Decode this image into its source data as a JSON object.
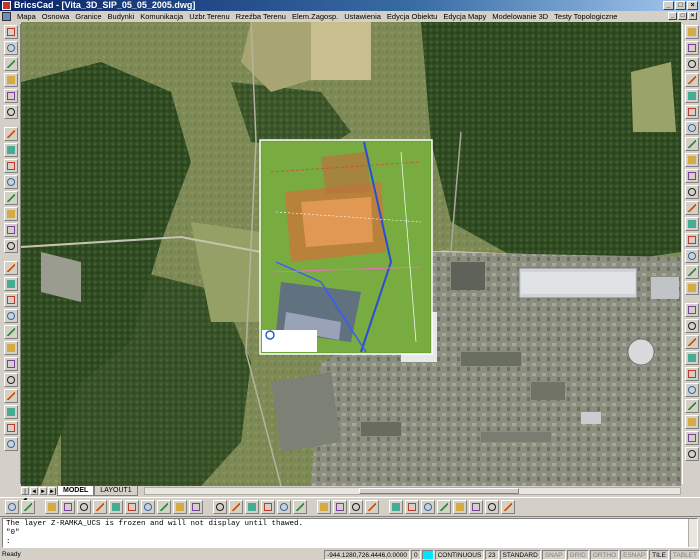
{
  "window": {
    "title": "BricsCad - [Vita_3D_SIP_05_05_2005.dwg]"
  },
  "menu": {
    "items": [
      "Mapa",
      "Osnowa",
      "Granice",
      "Budynki",
      "Komunikacja",
      "Uzbr.Terenu",
      "Rzeźba Terenu",
      "Elem.Zagosp.",
      "Ustawienia",
      "Edycja Obiektu",
      "Edycja Mapy",
      "Modelowanie 3D",
      "Testy Topologiczne"
    ]
  },
  "tabs": {
    "model": "MODEL",
    "layout": "LAYOUT1"
  },
  "command": {
    "line1": "The layer Z-RAMKA_UCS is frozen and will not display until thawed.",
    "line2": "\"0\"",
    "line3": ":"
  },
  "status": {
    "ready": "Ready",
    "coords": "-944.1280,726.4446,0.0000",
    "layer": "0",
    "linetype": "CONTINUOUS",
    "lineweight": "23",
    "dimstyle": "STANDARD",
    "toggles": [
      "SNAP",
      "GRID",
      "ORTHO",
      "ESNAP",
      "TILE",
      "TABLET"
    ],
    "toggles_on": [
      "TILE"
    ],
    "layer_color": "#00e5ff"
  },
  "icons": {
    "left_toolbar": [
      "properties-icon",
      "layer-icon",
      "building-icon",
      "road-icon",
      "network-icon",
      "measure-icon",
      "label-icon",
      "select-icon",
      "zoom-icon",
      "pan-icon",
      "draw-icon",
      "edit-icon",
      "text-icon",
      "block-icon",
      "insert-icon",
      "attribute-icon",
      "hatch-icon",
      "dimension-icon",
      "area-icon",
      "point-icon",
      "grid-icon",
      "snap-icon",
      "ortho-icon",
      "print-icon",
      "export-icon",
      "help-icon"
    ],
    "right_toolbar": [
      "circle-icon",
      "line-icon",
      "polyline-icon",
      "arc-icon",
      "point-icon",
      "rectangle-icon",
      "move-icon",
      "copy-icon",
      "mirror-icon",
      "rotate-icon",
      "scale-icon",
      "stretch-icon",
      "trim-icon",
      "extend-icon",
      "break-icon",
      "chamfer-icon",
      "fillet-icon",
      "explode-icon",
      "array-icon",
      "offset-icon",
      "erase-icon",
      "undo-icon",
      "redo-icon",
      "regen-icon",
      "layers-icon",
      "hatch-icon",
      "text-icon"
    ],
    "bottom_toolbar": [
      "select-arrow-icon",
      "polyline-tool-icon",
      "pan-hand-icon",
      "zoom-realtime-icon",
      "zoom-in-icon",
      "zoom-out-icon",
      "zoom-window-icon",
      "zoom-previous-icon",
      "zoom-extents-icon",
      "zoom-all-icon",
      "zoom-scale-icon",
      "redraw-icon",
      "view-icon",
      "properties-icon",
      "layer-manager-icon",
      "layer-previous-icon",
      "image-manager-icon",
      "raster-icon",
      "raster-clip-icon",
      "raster-frame-icon",
      "raster-adjust-icon",
      "globe-icon",
      "web-icon",
      "database-icon",
      "report-icon",
      "settings-icon",
      "print-icon",
      "export-icon",
      "save-icon",
      "open-icon"
    ]
  },
  "colors": {
    "titlebar": "#0a246a",
    "accent": "#00e5ff"
  }
}
